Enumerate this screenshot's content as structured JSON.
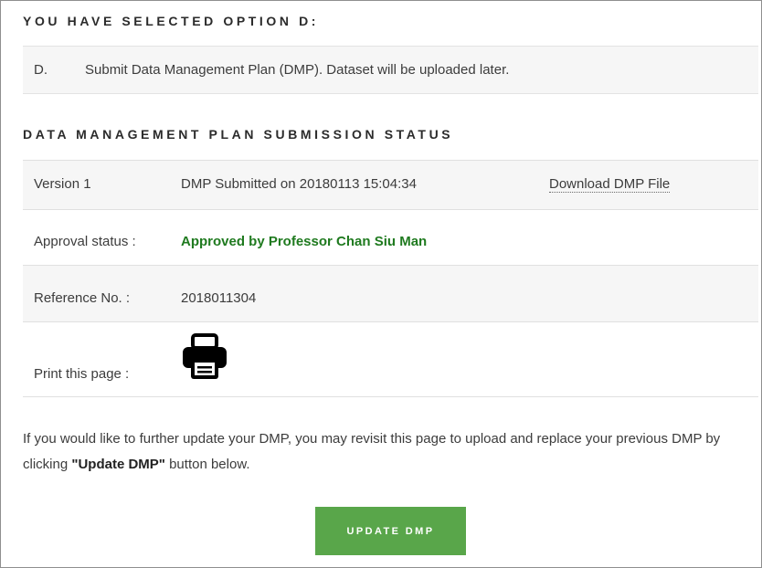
{
  "selected_option": {
    "heading": "YOU HAVE SELECTED OPTION D:",
    "letter": "D.",
    "description": "Submit Data Management Plan (DMP). Dataset will be uploaded later."
  },
  "submission_status": {
    "heading": "DATA MANAGEMENT PLAN SUBMISSION STATUS",
    "version_label": "Version 1",
    "submitted_text": "DMP Submitted on 20180113 15:04:34",
    "download_link": "Download DMP File",
    "approval_label": "Approval status :",
    "approval_value": "Approved by Professor Chan Siu Man",
    "reference_label": "Reference No. :",
    "reference_value": "2018011304",
    "print_label": "Print this page :",
    "print_icon": "printer-icon"
  },
  "instructions": {
    "text_before": "If you would like to further update your DMP, you may revisit this page to upload and replace your previous DMP by clicking ",
    "bold": "\"Update DMP\"",
    "text_after": " button below."
  },
  "update_button": {
    "label": "UPDATE DMP"
  },
  "colors": {
    "approved_green": "#1f7a1f",
    "button_green": "#59a64a",
    "row_shade": "#f6f6f6"
  }
}
